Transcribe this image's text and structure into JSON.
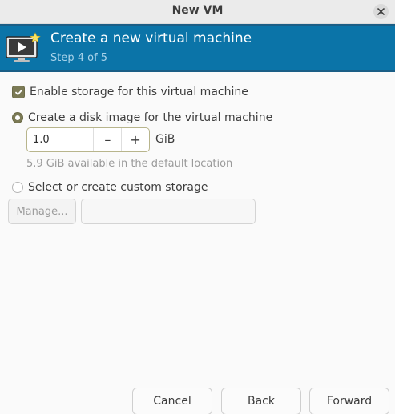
{
  "window": {
    "title": "New VM"
  },
  "banner": {
    "heading": "Create a new virtual machine",
    "step": "Step 4 of 5",
    "background_color": "#0b74a8"
  },
  "storage": {
    "enable_label": "Enable storage for this virtual machine",
    "enable_checked": true,
    "create_disk_label": "Create a disk image for the virtual machine",
    "create_disk_selected": true,
    "disk_size_value": "1.0",
    "disk_size_unit": "GiB",
    "available_hint": "5.9 GiB available in the default location",
    "custom_storage_label": "Select or create custom storage",
    "custom_storage_selected": false,
    "manage_label": "Manage...",
    "custom_path_value": ""
  },
  "buttons": {
    "cancel": "Cancel",
    "back": "Back",
    "forward": "Forward"
  },
  "colors": {
    "accent_check": "#7b7a55"
  }
}
